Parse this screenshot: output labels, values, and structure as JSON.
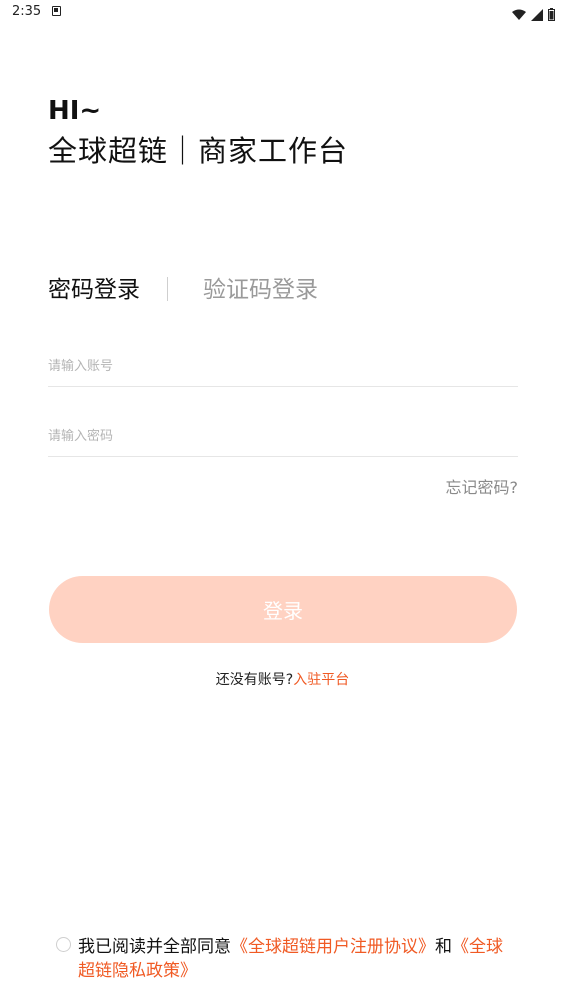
{
  "status_bar": {
    "time": "2:35"
  },
  "greeting": {
    "hi": "HI~",
    "title": "全球超链｜商家工作台"
  },
  "tabs": {
    "password_login": "密码登录",
    "code_login": "验证码登录"
  },
  "form": {
    "account_placeholder": "请输入账号",
    "password_placeholder": "请输入密码",
    "forgot_password": "忘记密码?",
    "login_button": "登录"
  },
  "register": {
    "prompt": "还没有账号?",
    "link": "入驻平台"
  },
  "agreement": {
    "prefix": "我已阅读并全部同意",
    "user_agreement": "《全球超链用户注册协议》",
    "and": "和",
    "privacy_policy": "《全球超链隐私政策》"
  },
  "colors": {
    "accent": "#f05a24",
    "button_disabled": "#ffd2c2"
  }
}
